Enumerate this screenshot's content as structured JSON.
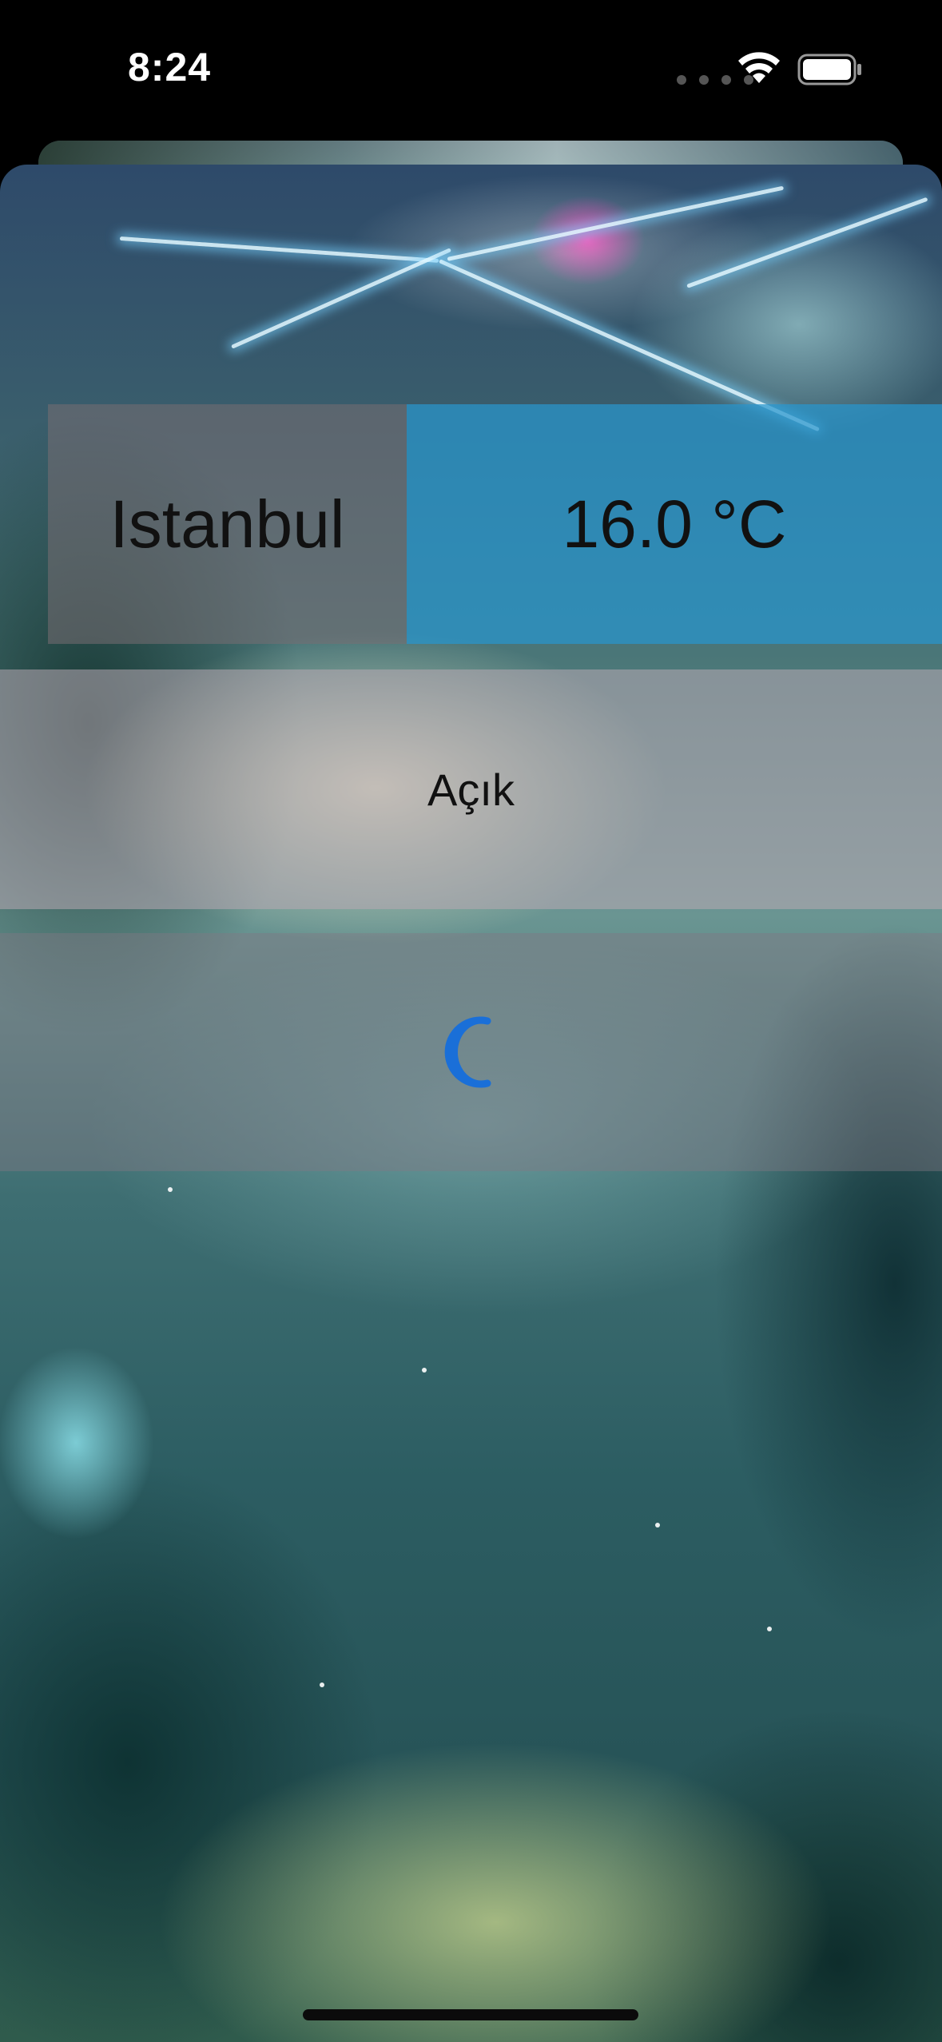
{
  "status_bar": {
    "time": "8:24"
  },
  "weather": {
    "city": "Istanbul",
    "temperature": "16.0 °C",
    "condition": "Açık",
    "condition_icon": "moon-icon"
  },
  "colors": {
    "temp_cell": "#2896cd",
    "city_cell": "#786e73",
    "moon_icon": "#1a6fd8"
  }
}
